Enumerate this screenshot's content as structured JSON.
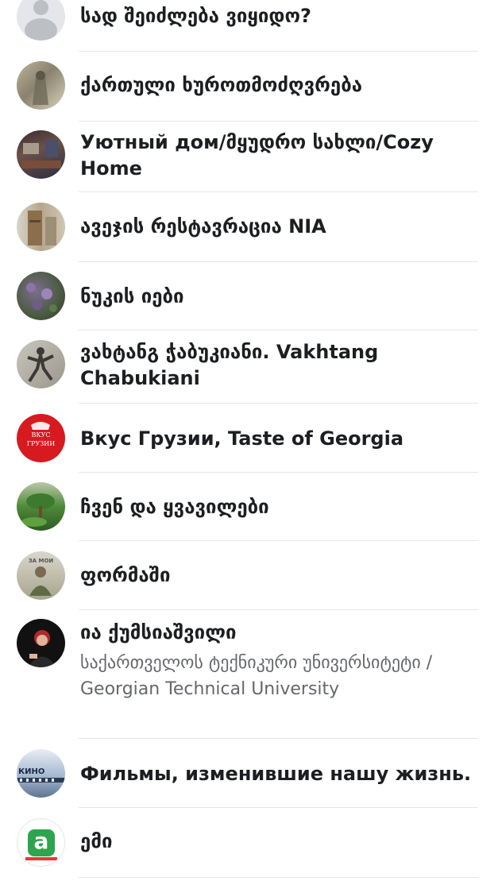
{
  "groups": [
    {
      "title": "სად შეიძლება ვიყიდო?",
      "avatar_icon": "default-profile-icon"
    },
    {
      "title": "ქართული ხუროთმოძღვრება",
      "avatar_icon": "stone-relief-photo"
    },
    {
      "title": "Уютный дом/მყუდრო სახლი/Cozy Home",
      "avatar_icon": "cozy-interior-photo"
    },
    {
      "title": "ავეჯის რესტავრაცია NIA",
      "avatar_icon": "furniture-photo"
    },
    {
      "title": "ნუკის იები",
      "avatar_icon": "violets-photo"
    },
    {
      "title": "ვახტანგ ჭაბუკიანი. Vakhtang Chabukiani",
      "avatar_icon": "dancer-photo"
    },
    {
      "title": "Вкус Грузии, Taste of Georgia",
      "avatar_icon": "red-logo",
      "avatar_text_1": "ВКУС",
      "avatar_text_2": "ГРУЗИИ"
    },
    {
      "title": "ჩვენ და ყვავილები",
      "avatar_icon": "flowers-photo"
    },
    {
      "title": "ფორმაში",
      "avatar_icon": "soldier-photo",
      "avatar_text_1": "ЗА МОИ"
    },
    {
      "title": "ია ქუმსიაშვილი",
      "subtitle": "საქართველოს ტექნიკური უნივერსიტეტი / Georgian Technical University",
      "avatar_icon": "person-photo"
    },
    {
      "title": "Фильмы, изменившие нашу жизнь.",
      "avatar_icon": "cinema-photo",
      "avatar_text_1": "КИНО"
    },
    {
      "title": "ემი",
      "avatar_icon": "green-letter-logo",
      "avatar_text_1": "a"
    }
  ],
  "colors": {
    "divider": "#e4e6eb",
    "title": "#1c1e21",
    "subtitle": "#65676b",
    "placeholder": "#bcc0c4"
  }
}
